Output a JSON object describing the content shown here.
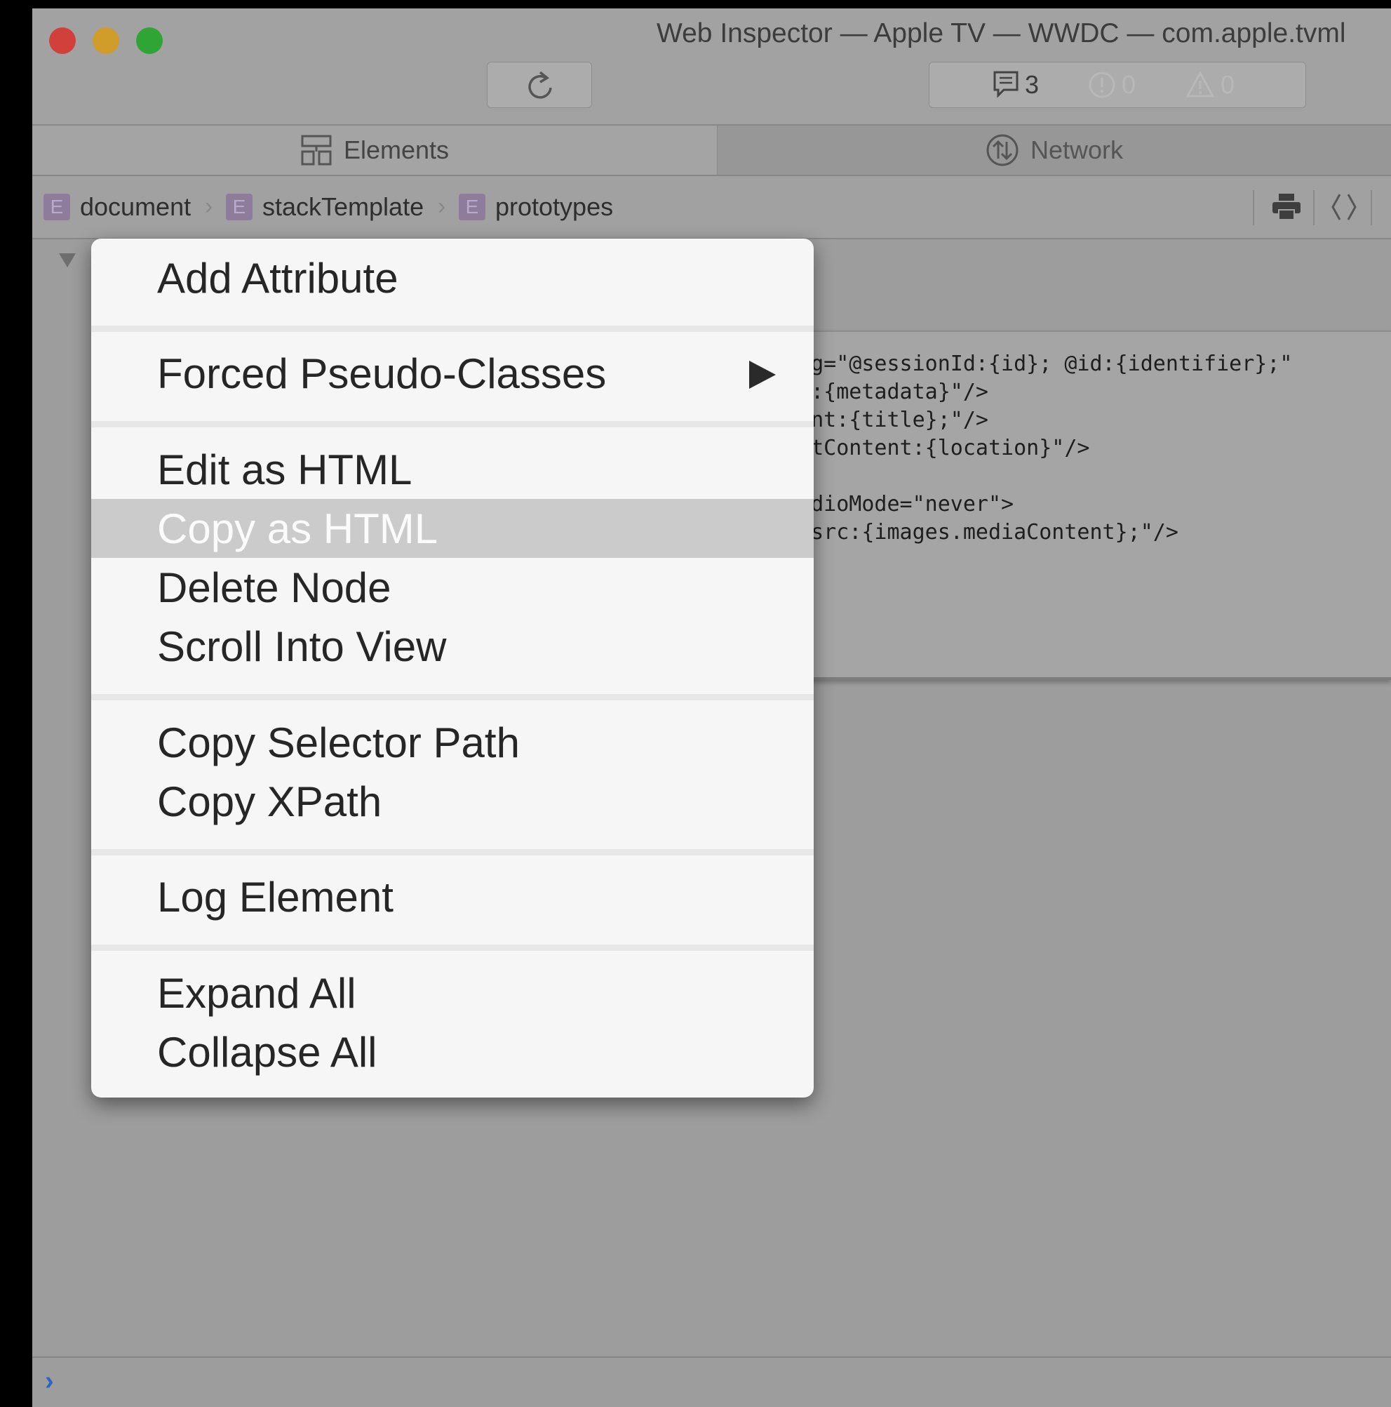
{
  "window": {
    "title": "Web Inspector — Apple TV — WWDC — com.apple.tvml"
  },
  "toolbar": {
    "messages_count": "3",
    "errors_count": "0",
    "warnings_count": "0"
  },
  "tabs": [
    {
      "label": "Elements",
      "icon": "elements-icon"
    },
    {
      "label": "Network",
      "icon": "network-icon"
    }
  ],
  "breadcrumbs": [
    {
      "badge": "E",
      "label": "document"
    },
    {
      "badge": "E",
      "label": "stackTemplate"
    },
    {
      "badge": "E",
      "label": "prototypes"
    }
  ],
  "code_lines": [
    "ing=\"@sessionId:{id}; @id:{identifier};\"",
    "nt:{metadata}\"/>",
    "tent:{title};\"/>",
    "extContent:{location}\"/>",
    "",
    "audioMode=\"never\">",
    "\"@src:{images.mediaContent};\"/>"
  ],
  "context_menu": {
    "items": [
      "Add Attribute",
      "Forced Pseudo-Classes",
      "Edit as HTML",
      "Copy as HTML",
      "Delete Node",
      "Scroll Into View",
      "Copy Selector Path",
      "Copy XPath",
      "Log Element",
      "Expand All",
      "Collapse All"
    ],
    "highlighted": "Copy as HTML"
  },
  "console": {
    "prompt": "›"
  },
  "colors": {
    "close": "#d2403c",
    "minimize": "#d09c2a",
    "maximize": "#2ea535",
    "highlight": "#cbcbcb",
    "prompt": "#2a64c8"
  }
}
